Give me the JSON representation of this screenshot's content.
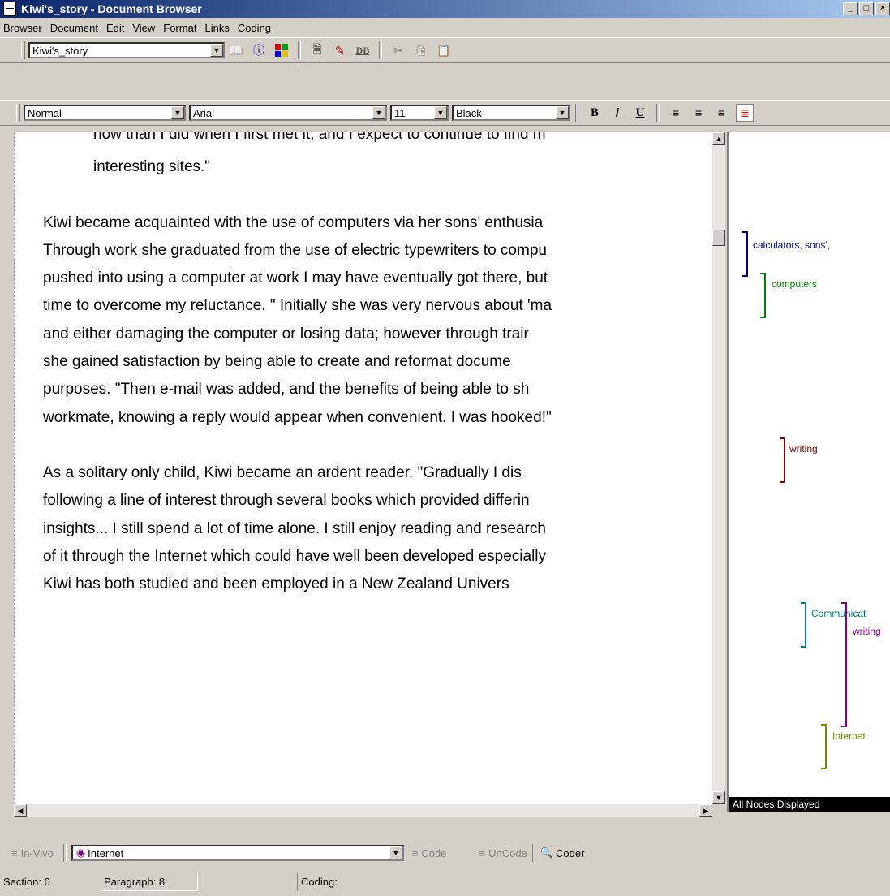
{
  "window": {
    "title": "Kiwi's_story - Document Browser",
    "min": "_",
    "max": "□",
    "close": "×"
  },
  "menu": [
    "Browser",
    "Document",
    "Edit",
    "View",
    "Format",
    "Links",
    "Coding"
  ],
  "toolbar1": {
    "document_select": "Kiwi's_story",
    "db_label": "DB"
  },
  "toolbar2": {
    "style": "Normal",
    "font": "Arial",
    "size": "11",
    "color": "Black",
    "bold": "B",
    "italic": "/",
    "underline": "U"
  },
  "document": {
    "indented_lines": [
      "now than I did when I first met it, and I expect to continue to find m",
      "interesting sites.\""
    ],
    "para1": [
      "Kiwi became acquainted with the use of computers via her sons' enthusia",
      "Through work she graduated from the use of electric typewriters to compu",
      "pushed into using a computer at work I may have eventually got there, but",
      "time to overcome my reluctance. \" Initially she was very nervous about 'ma",
      "and either damaging the computer or losing data; however through trair",
      "she gained satisfaction by being able to create and reformat docume",
      "purposes. \"Then e-mail was added, and the benefits of being able to sh",
      "workmate, knowing a reply would appear when convenient. I was hooked!\""
    ],
    "para2": [
      "As a solitary only child, Kiwi became an ardent reader. \"Gradually I dis",
      "following a line of interest through several books which provided differin",
      "insights... I still spend a lot of time alone. I still enjoy reading and research",
      "of it through the Internet which could have well been developed especially",
      "Kiwi has both studied and been employed in a New Zealand Univers"
    ]
  },
  "coding_stripes": {
    "nodes": [
      {
        "label": "calculators, sons',",
        "color": "#000080"
      },
      {
        "label": "computers",
        "color": "#008000"
      },
      {
        "label": "writing",
        "color": "#800000"
      },
      {
        "label": "Communicat",
        "color": "#008080"
      },
      {
        "label": "writing",
        "color": "#800080"
      },
      {
        "label": "Internet",
        "color": "#808000"
      }
    ],
    "footer": "All Nodes Displayed"
  },
  "coder_bar": {
    "in_vivo": "In-Vivo",
    "node_select": "Internet",
    "code": "Code",
    "uncode": "UnCode",
    "coder": "Coder"
  },
  "status": {
    "section": "Section: 0",
    "paragraph": "Paragraph: 8",
    "coding": "Coding:"
  }
}
